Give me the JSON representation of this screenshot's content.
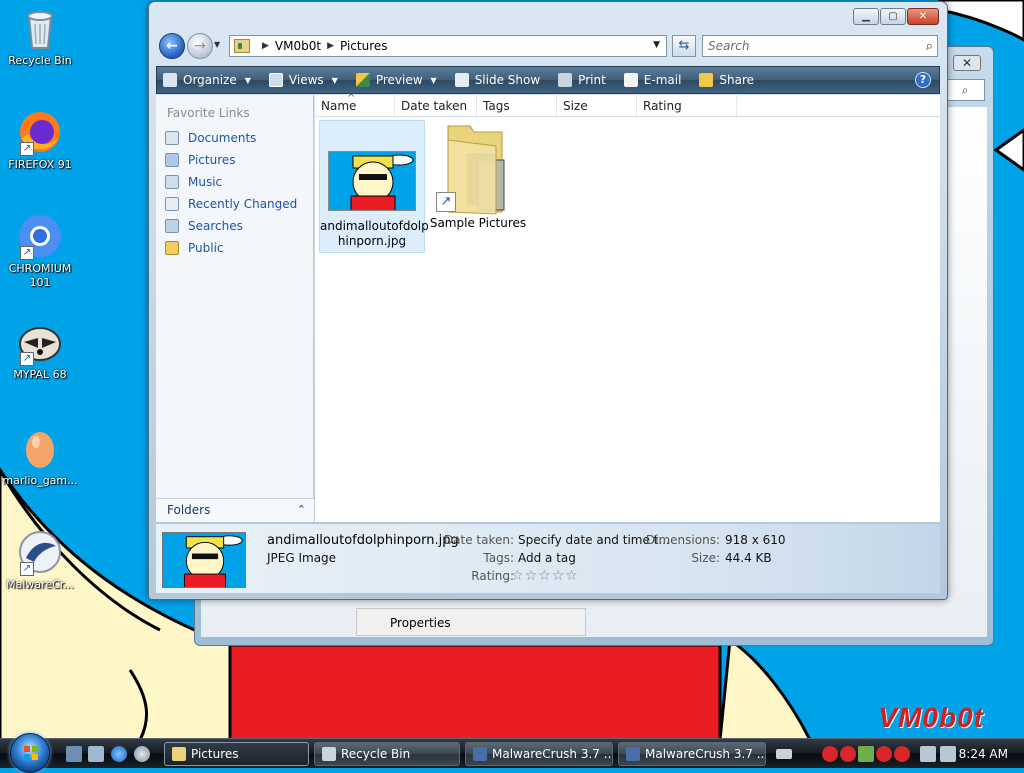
{
  "desktop": {
    "icons": [
      {
        "label": "Recycle Bin",
        "icon": "recycle-bin-icon"
      },
      {
        "label": "FIREFOX 91",
        "icon": "firefox-icon"
      },
      {
        "label": "CHROMIUM 101",
        "icon": "chromium-icon"
      },
      {
        "label": "MYPAL 68",
        "icon": "mypal-icon"
      },
      {
        "label": "marlio_gam...",
        "icon": "egg-icon"
      },
      {
        "label": "MalwareCr...",
        "icon": "malwarecrush-icon"
      }
    ],
    "watermark": "VM0b0t"
  },
  "background_window": {
    "context_item": "Properties"
  },
  "explorer": {
    "address": {
      "crumbs": [
        "VM0b0t",
        "Pictures"
      ],
      "search_placeholder": "Search"
    },
    "toolbar": [
      {
        "label": "Organize",
        "icon": "organize-icon",
        "has_dropdown": true
      },
      {
        "label": "Views",
        "icon": "views-icon",
        "has_dropdown": true
      },
      {
        "label": "Preview",
        "icon": "preview-icon",
        "has_dropdown": true
      },
      {
        "label": "Slide Show",
        "icon": "slideshow-icon"
      },
      {
        "label": "Print",
        "icon": "printer-icon"
      },
      {
        "label": "E-mail",
        "icon": "email-icon"
      },
      {
        "label": "Share",
        "icon": "share-icon"
      }
    ],
    "nav": {
      "heading": "Favorite Links",
      "items": [
        {
          "label": "Documents",
          "icon": "documents-icon"
        },
        {
          "label": "Pictures",
          "icon": "pictures-icon"
        },
        {
          "label": "Music",
          "icon": "music-icon"
        },
        {
          "label": "Recently Changed",
          "icon": "recently-changed-icon"
        },
        {
          "label": "Searches",
          "icon": "searches-icon"
        },
        {
          "label": "Public",
          "icon": "public-folder-icon"
        }
      ],
      "folders_label": "Folders"
    },
    "columns": [
      "Name",
      "Date taken",
      "Tags",
      "Size",
      "Rating"
    ],
    "sorted_column": "Name",
    "files": [
      {
        "name": "andimalloutofdolphinporn.jpg",
        "name_line1": "andimalloutofdolp",
        "name_line2": "hinporn.jpg",
        "type": "image",
        "selected": true
      },
      {
        "name": "Sample Pictures",
        "type": "folder-shortcut",
        "selected": false
      }
    ],
    "details": {
      "filename": "andimalloutofdolphinporn.jpg",
      "filetype": "JPEG Image",
      "date_taken_label": "Date taken:",
      "date_taken_value": "Specify date and time t...",
      "tags_label": "Tags:",
      "tags_value": "Add a tag",
      "rating_label": "Rating:",
      "rating_stars": 0,
      "rating_max": 5,
      "dimensions_label": "Dimensions:",
      "dimensions_value": "918 x 610",
      "size_label": "Size:",
      "size_value": "44.4 KB"
    }
  },
  "taskbar": {
    "buttons": [
      {
        "label": "Pictures",
        "icon": "pictures-folder-icon",
        "active": true
      },
      {
        "label": "Recycle Bin",
        "icon": "recycle-bin-icon",
        "active": false
      },
      {
        "label": "MalwareCrush 3.7 ...",
        "icon": "malwarecrush-icon",
        "active": false
      },
      {
        "label": "MalwareCrush 3.7 ...",
        "icon": "malwarecrush-icon",
        "active": false
      }
    ],
    "clock": "8:24 AM"
  },
  "colors": {
    "desktop_blue": "#00a2e8",
    "link_blue": "#1e54a6",
    "toolbar_dark": "#3e5e7a",
    "watermark_red": "#d1201f"
  }
}
